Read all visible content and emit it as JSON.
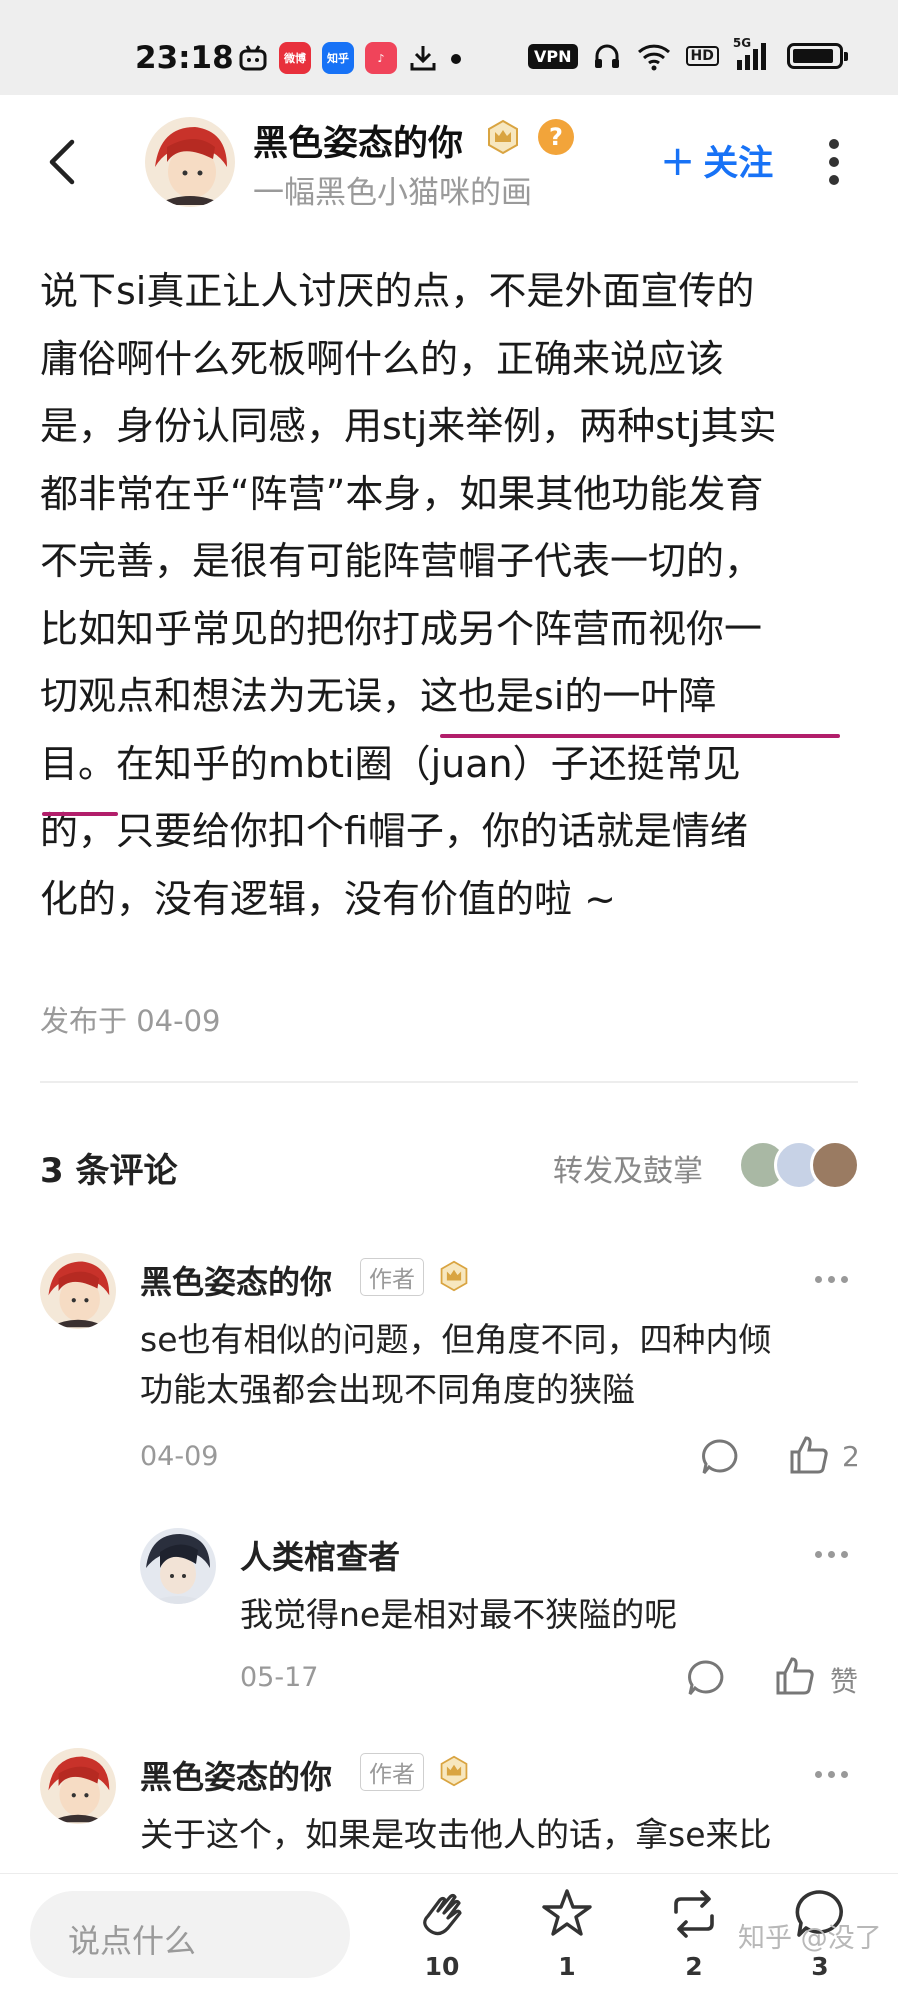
{
  "status_bar": {
    "time": "23:18",
    "app_badges": [
      "微博",
      "知乎"
    ],
    "vpn_label": "VPN",
    "hd_label": "HD",
    "network_label": "5G",
    "battery_level": 0.9
  },
  "header": {
    "author_name": "黑色姿态的你",
    "author_bio": "一幅黑色小猫咪的画",
    "follow_label": "关注",
    "follow_plus": "+"
  },
  "article": {
    "lines": [
      "说下si真正让人讨厌的点，不是外面宣传的",
      "庸俗啊什么死板啊什么的，正确来说应该",
      "是，身份认同感，用stj来举例，两种stj其实",
      "都非常在乎“阵营”本身，如果其他功能发育",
      "不完善，是很有可能阵营帽子代表一切的，",
      "比如知乎常见的把你打成另个阵营而视你一",
      "切观点和想法为无误，这也是si的一叶障",
      "目。在知乎的mbti圈（juan）子还挺常见",
      "的，只要给你扣个fi帽子，你的话就是情绪",
      "化的，没有逻辑，没有价值的啦 ~"
    ],
    "publish_date": "发布于 04-09"
  },
  "comments_section": {
    "count_label": "3 条评论",
    "forward_label": "转发及鼓掌"
  },
  "comments": [
    {
      "name": "黑色姿态的你",
      "tag": "作者",
      "lines": [
        "se也有相似的问题，但角度不同，四种内倾",
        "功能太强都会出现不同角度的狭隘"
      ],
      "date": "04-09",
      "likes": "2"
    },
    {
      "name": "人类棺查者",
      "lines": [
        "我觉得ne是相对最不狭隘的呢"
      ],
      "date": "05-17",
      "likes": "赞"
    },
    {
      "name": "黑色姿态的你",
      "tag": "作者",
      "lines": [
        "关于这个，如果是攻击他人的话，拿se来比"
      ]
    }
  ],
  "bottom_bar": {
    "input_placeholder": "说点什么",
    "clap_count": "10",
    "star_count": "1",
    "repost_count": "2",
    "comment_count": "3",
    "watermark": "知乎 @没了"
  },
  "colors": {
    "accent": "#1772f6",
    "underline": "#b21e6b",
    "crown_gold": "#d9a441",
    "help_orange": "#f2a43a"
  }
}
